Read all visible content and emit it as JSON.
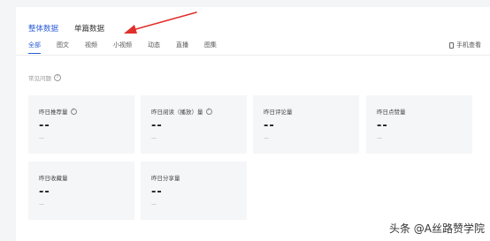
{
  "top_tabs": [
    {
      "label": "整体数据",
      "active": true
    },
    {
      "label": "单篇数据",
      "active": false
    }
  ],
  "sub_tabs": [
    {
      "label": "全部",
      "active": true
    },
    {
      "label": "图文",
      "active": false
    },
    {
      "label": "视频",
      "active": false
    },
    {
      "label": "小视频",
      "active": false
    },
    {
      "label": "动态",
      "active": false
    },
    {
      "label": "直播",
      "active": false
    },
    {
      "label": "图集",
      "active": false
    }
  ],
  "mobile_view_label": "手机查看",
  "section_title": "常见问题",
  "cards": [
    {
      "label": "昨日推荐量",
      "value": "--",
      "sub": "—"
    },
    {
      "label": "昨日阅读（播放）量",
      "value": "--",
      "sub": "—"
    },
    {
      "label": "昨日评论量",
      "value": "--",
      "sub": "—"
    },
    {
      "label": "昨日点赞量",
      "value": "--",
      "sub": "—"
    },
    {
      "label": "昨日收藏量",
      "value": "--",
      "sub": "—"
    },
    {
      "label": "昨日分享量",
      "value": "--",
      "sub": "—"
    }
  ],
  "watermark": "头条 @A丝路赞学院",
  "colors": {
    "accent": "#2a5bd7",
    "arrow": "#e0302a"
  }
}
